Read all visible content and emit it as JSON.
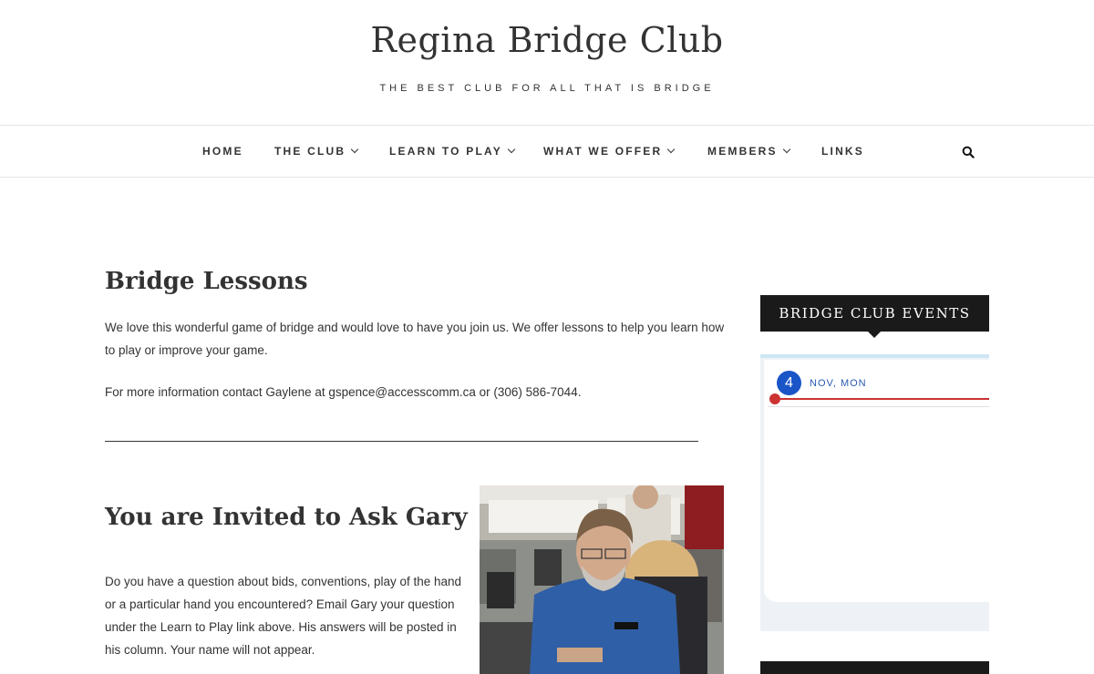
{
  "site": {
    "title": "Regina Bridge Club",
    "tagline": "THE BEST CLUB FOR ALL THAT IS BRIDGE"
  },
  "nav": {
    "items": [
      {
        "label": "HOME"
      },
      {
        "label": "THE CLUB"
      },
      {
        "label": "LEARN TO PLAY"
      },
      {
        "label": "WHAT WE OFFER"
      },
      {
        "label": "MEMBERS"
      },
      {
        "label": "LINKS"
      }
    ],
    "search_icon": "search-icon"
  },
  "main": {
    "section1": {
      "heading": "Bridge Lessons",
      "p1": "We love this wonderful game of bridge and would love to have you join us. We offer lessons to help you learn how to play or improve your game.",
      "p2": "For more information contact Gaylene at gspence@accesscomm.ca or (306) 586-7044."
    },
    "section2": {
      "heading": "You are Invited to Ask Gary",
      "p1": "Do you have a question about bids, conventions, play of the hand or a particular hand you encountered? Email Gary your question under the Learn to Play link above. His answers will be posted in his column. Your name will not appear."
    }
  },
  "sidebar": {
    "events": {
      "title": "BRIDGE CLUB EVENTS",
      "day_number": "4",
      "day_label": "NOV, MON"
    }
  },
  "colors": {
    "accent_blue": "#1a55c8",
    "today_red": "#cc3333",
    "widget_dark": "#1a1a1a"
  }
}
